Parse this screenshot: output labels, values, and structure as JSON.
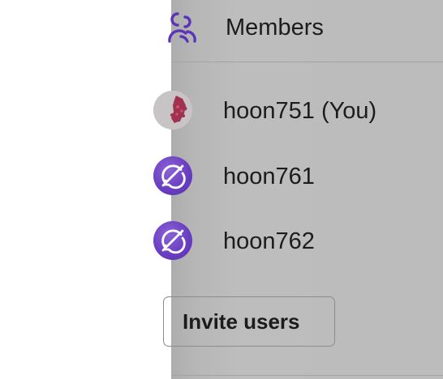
{
  "members_panel": {
    "title": "Members",
    "title_icon": "users-icon",
    "members": [
      {
        "name": "hoon751 (You)",
        "avatar": "profile-photo"
      },
      {
        "name": "hoon761",
        "avatar": "no-photo-icon"
      },
      {
        "name": "hoon762",
        "avatar": "no-photo-icon"
      }
    ],
    "invite_button_label": "Invite users"
  },
  "colors": {
    "panel_background": "#bcbcbc",
    "avatar_placeholder": "#6b3fc2",
    "icon_accent": "#5b34b8",
    "text": "#1c1c1c"
  }
}
